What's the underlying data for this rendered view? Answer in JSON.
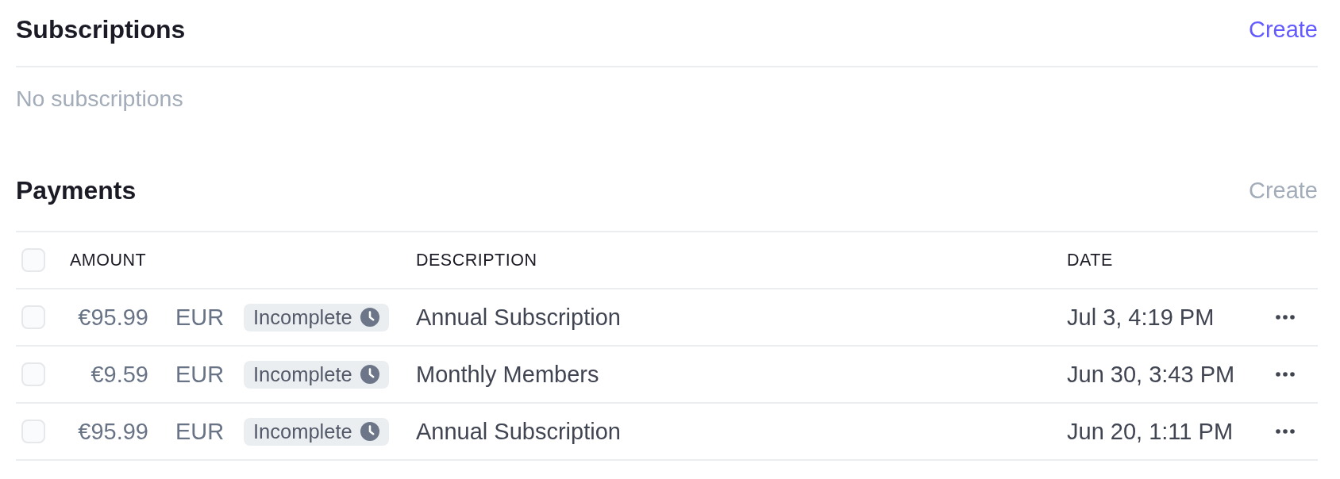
{
  "subscriptions": {
    "title": "Subscriptions",
    "create": {
      "label": "Create",
      "disabled": false
    },
    "empty_message": "No subscriptions"
  },
  "payments": {
    "title": "Payments",
    "create": {
      "label": "Create",
      "disabled": true
    },
    "table": {
      "select_all": {
        "checked": false
      },
      "columns": [
        "AMOUNT",
        "DESCRIPTION",
        "DATE"
      ],
      "rows": [
        {
          "checked": false,
          "amount": "€95.99",
          "currency": "EUR",
          "status": "Incomplete",
          "description": "Annual Subscription",
          "date": "Jul 3, 4:19 PM"
        },
        {
          "checked": false,
          "amount": "€9.59",
          "currency": "EUR",
          "status": "Incomplete",
          "description": "Monthly Members",
          "date": "Jun 30, 3:43 PM"
        },
        {
          "checked": false,
          "amount": "€95.99",
          "currency": "EUR",
          "status": "Incomplete",
          "description": "Annual Subscription",
          "date": "Jun 20, 1:11 PM"
        }
      ]
    }
  }
}
